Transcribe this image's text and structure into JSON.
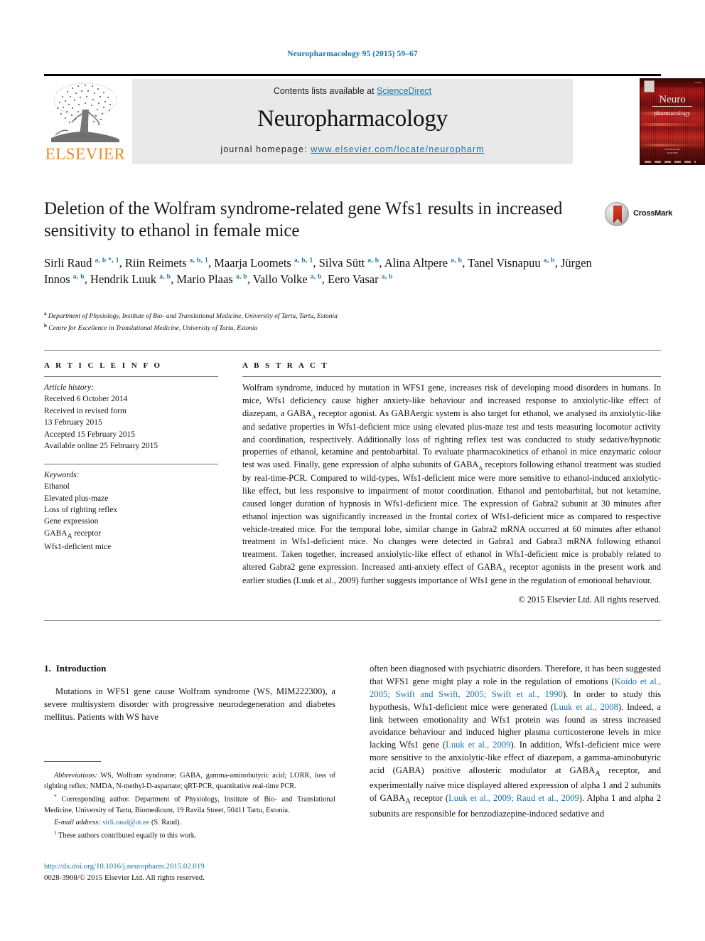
{
  "running_head": "Neuropharmacology 95 (2015) 59–67",
  "masthead": {
    "contents_prefix": "Contents lists available at ",
    "sciencedirect": "ScienceDirect",
    "journal_title": "Neuropharmacology",
    "homepage_prefix": "journal homepage: ",
    "homepage_url": "www.elsevier.com/locate/neuropharm",
    "publisher": "ELSEVIER",
    "cover_title_line1": "Neuro",
    "cover_title_line2": "pharmacology",
    "accent_color": "#1a72a8",
    "publisher_color": "#eb8b22"
  },
  "article": {
    "title": "Deletion of the Wolfram syndrome-related gene Wfs1 results in increased sensitivity to ethanol in female mice",
    "crossmark_label": "CrossMark",
    "authors": [
      {
        "name": "Sirli Raud",
        "marks": "a, b *, 1",
        "sep": ", "
      },
      {
        "name": "Riin Reimets",
        "marks": "a, b, 1",
        "sep": ", "
      },
      {
        "name": "Maarja Loomets",
        "marks": "a, b, 1",
        "sep": ", "
      },
      {
        "name": "Silva Sütt",
        "marks": "a, b",
        "sep": ", "
      },
      {
        "name": "Alina Altpere",
        "marks": "a, b",
        "sep": ", "
      },
      {
        "name": "Tanel Visnapuu",
        "marks": "a, b",
        "sep": ", "
      },
      {
        "name": "Jürgen Innos",
        "marks": "a, b",
        "sep": ", "
      },
      {
        "name": "Hendrik Luuk",
        "marks": "a, b",
        "sep": ", "
      },
      {
        "name": "Mario Plaas",
        "marks": "a, b",
        "sep": ", "
      },
      {
        "name": "Vallo Volke",
        "marks": "a, b",
        "sep": ", "
      },
      {
        "name": "Eero Vasar",
        "marks": "a, b",
        "sep": ""
      }
    ],
    "affiliations": [
      {
        "mark": "a",
        "text": "Department of Physiology, Institute of Bio- and Translational Medicine, University of Tartu, Tartu, Estonia"
      },
      {
        "mark": "b",
        "text": "Centre for Excellence in Translational Medicine, University of Tartu, Estonia"
      }
    ]
  },
  "info": {
    "heading": "A R T I C L E  I N F O",
    "history_label": "Article history:",
    "history": [
      "Received 6 October 2014",
      "Received in revised form",
      "13 February 2015",
      "Accepted 15 February 2015",
      "Available online 25 February 2015"
    ],
    "keywords_label": "Keywords:",
    "keywords": [
      "Ethanol",
      "Elevated plus-maze",
      "Loss of righting reflex",
      "Gene expression",
      "GABAA receptor",
      "Wfs1-deficient mice"
    ]
  },
  "abstract": {
    "heading": "A B S T R A C T",
    "text": "Wolfram syndrome, induced by mutation in WFS1 gene, increases risk of developing mood disorders in humans. In mice, Wfs1 deficiency cause higher anxiety-like behaviour and increased response to anxiolytic-like effect of diazepam, a GABAA receptor agonist. As GABAergic system is also target for ethanol, we analysed its anxiolytic-like and sedative properties in Wfs1-deficient mice using elevated plus-maze test and tests measuring locomotor activity and coordination, respectively. Additionally loss of righting reflex test was conducted to study sedative/hypnotic properties of ethanol, ketamine and pentobarbital. To evaluate pharmacokinetics of ethanol in mice enzymatic colour test was used. Finally, gene expression of alpha subunits of GABAA receptors following ethanol treatment was studied by real-time-PCR. Compared to wild-types, Wfs1-deficient mice were more sensitive to ethanol-induced anxiolytic-like effect, but less responsive to impairment of motor coordination. Ethanol and pentobarbital, but not ketamine, caused longer duration of hypnosis in Wfs1-deficient mice. The expression of Gabra2 subunit at 30 minutes after ethanol injection was significantly increased in the frontal cortex of Wfs1-deficient mice as compared to respective vehicle-treated mice. For the temporal lobe, similar change in Gabra2 mRNA occurred at 60 minutes after ethanol treatment in Wfs1-deficient mice. No changes were detected in Gabra1 and Gabra3 mRNA following ethanol treatment. Taken together, increased anxiolytic-like effect of ethanol in Wfs1-deficient mice is probably related to altered Gabra2 gene expression. Increased anti-anxiety effect of GABAA receptor agonists in the present work and earlier studies (Luuk et al., 2009) further suggests importance of Wfs1 gene in the regulation of emotional behaviour.",
    "copyright": "© 2015 Elsevier Ltd. All rights reserved."
  },
  "intro": {
    "heading_num": "1.",
    "heading": "Introduction",
    "left_paragraph": "Mutations in WFS1 gene cause Wolfram syndrome (WS, MIM222300), a severe multisystem disorder with progressive neurodegeneration and diabetes mellitus. Patients with WS have",
    "right_paragraph_1": "often been diagnosed with psychiatric disorders. Therefore, it has been suggested that WFS1 gene might play a role in the regulation of emotions (",
    "right_cite_1": "Koido et al., 2005; Swift and Swift, 2005; Swift et al., 1990",
    "right_paragraph_2": "). In order to study this hypothesis, Wfs1-deficient mice were generated (",
    "right_cite_2": "Luuk et al., 2008",
    "right_paragraph_3": "). Indeed, a link between emotionality and Wfs1 protein was found as stress increased avoidance behaviour and induced higher plasma corticosterone levels in mice lacking Wfs1 gene (",
    "right_cite_3": "Luuk et al., 2009",
    "right_paragraph_4": "). In addition, Wfs1-deficient mice were more sensitive to the anxiolytic-like effect of diazepam, a gamma-aminobutyric acid (GABA) positive allosteric modulator at GABAA receptor, and experimentally naive mice displayed altered expression of alpha 1 and 2 subunits of GABAA receptor (",
    "right_cite_4": "Luuk et al., 2009; Raud et al., 2009",
    "right_paragraph_5": "). Alpha 1 and alpha 2 subunits are responsible for benzodiazepine-induced sedative and"
  },
  "footnotes": {
    "abbreviations_label": "Abbreviations:",
    "abbreviations_text": " WS, Wolfram syndrome; GABA, gamma-aminobutyric acid; LORR, loss of righting reflex; NMDA, N-methyl-D-aspartate; qRT-PCR, quantitative real-time PCR.",
    "corresponding_marker": "*",
    "corresponding_text": " Corresponding author. Department of Physiology, Institute of Bio- and Translational Medicine, University of Tartu, Biomedicum, 19 Ravila Street, 50411 Tartu, Estonia.",
    "email_label": "E-mail address:",
    "email": "sirli.raud@ut.ee",
    "email_suffix": " (S. Raud).",
    "equal_marker": "1",
    "equal_text": " These authors contributed equally to this work."
  },
  "footer": {
    "doi": "http://dx.doi.org/10.1016/j.neuropharm.2015.02.019",
    "issn_copyright": "0028-3908/© 2015 Elsevier Ltd. All rights reserved."
  }
}
